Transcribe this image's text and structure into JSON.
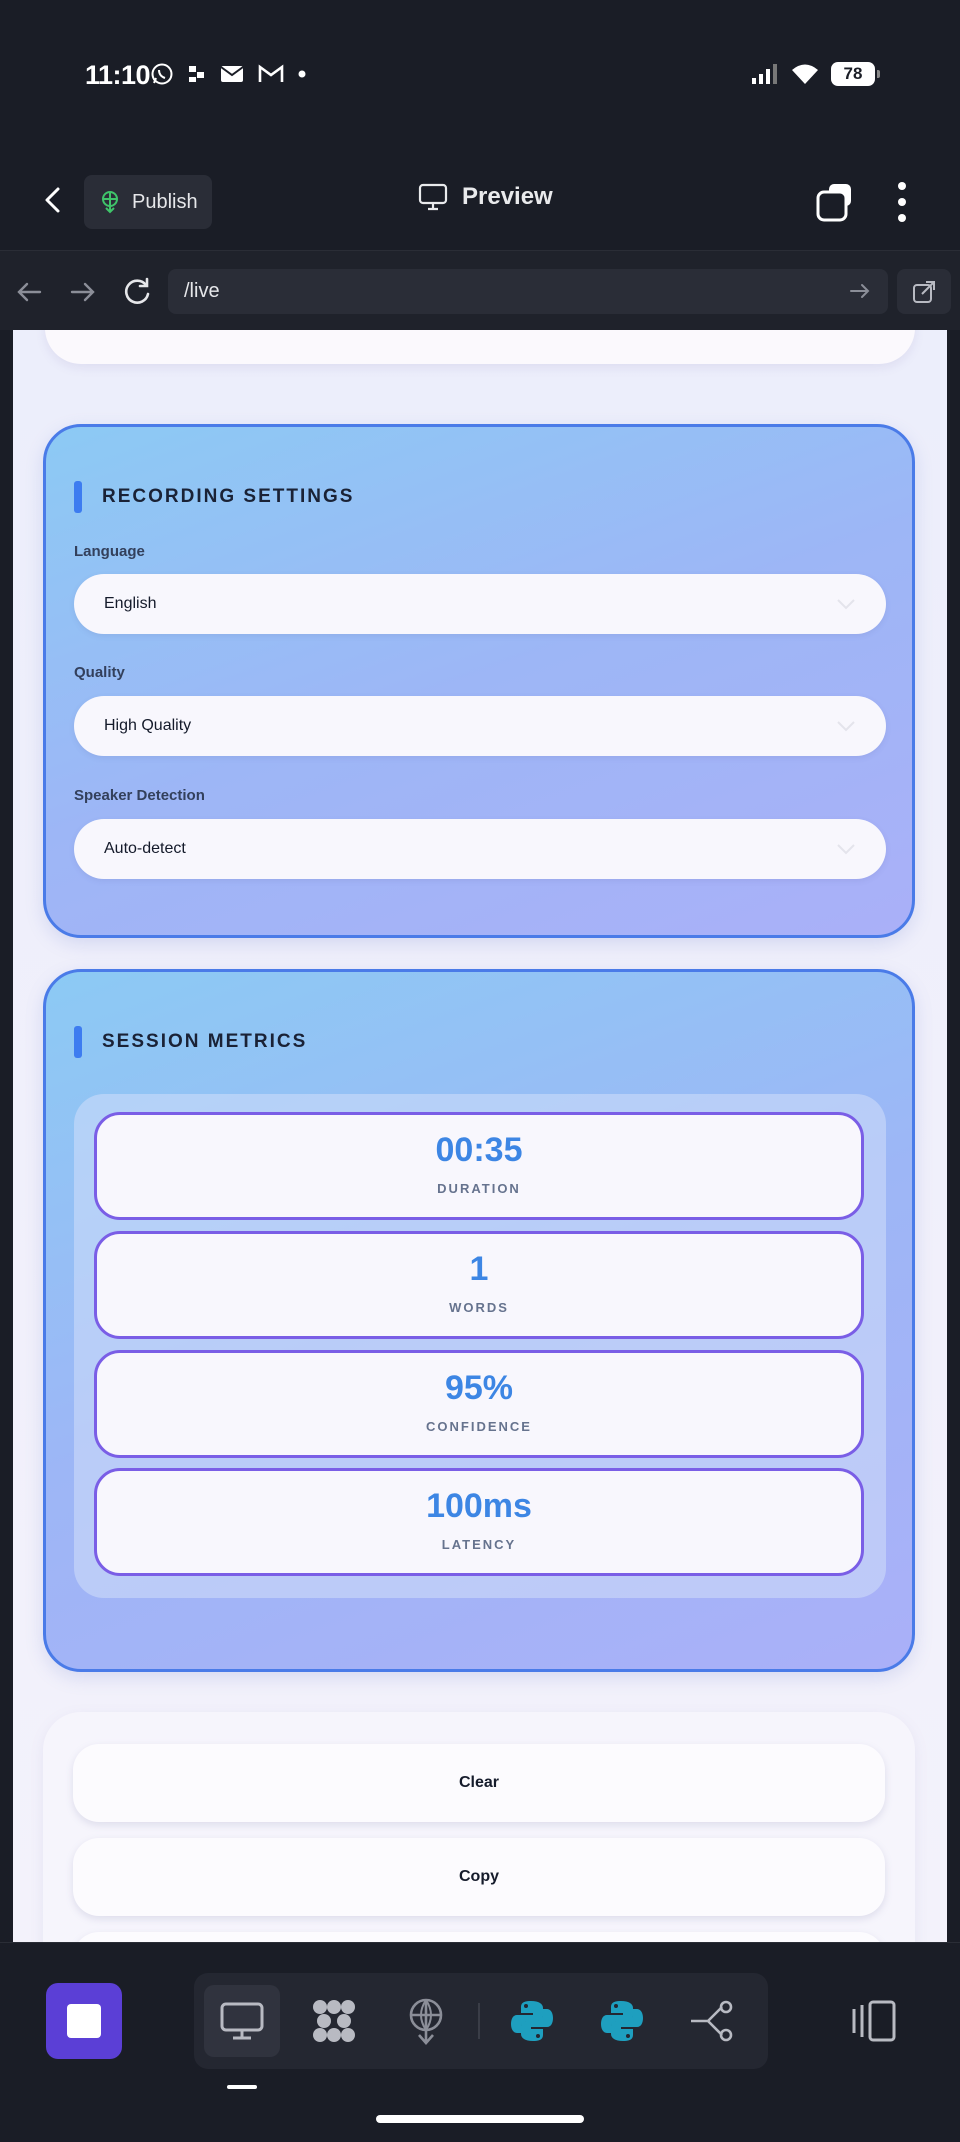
{
  "status_bar": {
    "time": "11:10",
    "battery": "78"
  },
  "header": {
    "publish_label": "Publish",
    "title": "Preview"
  },
  "browser": {
    "url": "/live"
  },
  "recording_settings": {
    "title": "RECORDING SETTINGS",
    "fields": [
      {
        "label": "Language",
        "value": "English"
      },
      {
        "label": "Quality",
        "value": "High Quality"
      },
      {
        "label": "Speaker Detection",
        "value": "Auto-detect"
      }
    ]
  },
  "session_metrics": {
    "title": "SESSION METRICS",
    "items": [
      {
        "value": "00:35",
        "label": "DURATION"
      },
      {
        "value": "1",
        "label": "WORDS"
      },
      {
        "value": "95%",
        "label": "CONFIDENCE"
      },
      {
        "value": "100ms",
        "label": "LATENCY"
      }
    ]
  },
  "actions": {
    "clear_label": "Clear",
    "copy_label": "Copy"
  },
  "colors": {
    "accent": "#4a7be8",
    "metric_value": "#3d86e4",
    "stop_button": "#5b3fd6"
  },
  "icons": {
    "bottom_tools": [
      "monitor-icon",
      "dots-grid-icon",
      "globe-deploy-icon",
      "python-icon",
      "python-icon",
      "share-icon"
    ]
  }
}
